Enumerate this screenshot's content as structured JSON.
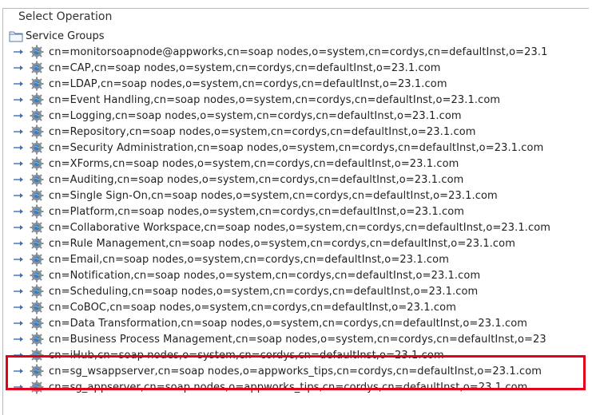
{
  "panel": {
    "title": "Select Operation"
  },
  "tree": {
    "root_label": "Service Groups",
    "items": [
      "cn=monitorsoapnode@appworks,cn=soap nodes,o=system,cn=cordys,cn=defaultInst,o=23.1",
      "cn=CAP,cn=soap nodes,o=system,cn=cordys,cn=defaultInst,o=23.1.com",
      "cn=LDAP,cn=soap nodes,o=system,cn=cordys,cn=defaultInst,o=23.1.com",
      "cn=Event Handling,cn=soap nodes,o=system,cn=cordys,cn=defaultInst,o=23.1.com",
      "cn=Logging,cn=soap nodes,o=system,cn=cordys,cn=defaultInst,o=23.1.com",
      "cn=Repository,cn=soap nodes,o=system,cn=cordys,cn=defaultInst,o=23.1.com",
      "cn=Security Administration,cn=soap nodes,o=system,cn=cordys,cn=defaultInst,o=23.1.com",
      "cn=XForms,cn=soap nodes,o=system,cn=cordys,cn=defaultInst,o=23.1.com",
      "cn=Auditing,cn=soap nodes,o=system,cn=cordys,cn=defaultInst,o=23.1.com",
      "cn=Single Sign-On,cn=soap nodes,o=system,cn=cordys,cn=defaultInst,o=23.1.com",
      "cn=Platform,cn=soap nodes,o=system,cn=cordys,cn=defaultInst,o=23.1.com",
      "cn=Collaborative Workspace,cn=soap nodes,o=system,cn=cordys,cn=defaultInst,o=23.1.com",
      "cn=Rule Management,cn=soap nodes,o=system,cn=cordys,cn=defaultInst,o=23.1.com",
      "cn=Email,cn=soap nodes,o=system,cn=cordys,cn=defaultInst,o=23.1.com",
      "cn=Notification,cn=soap nodes,o=system,cn=cordys,cn=defaultInst,o=23.1.com",
      "cn=Scheduling,cn=soap nodes,o=system,cn=cordys,cn=defaultInst,o=23.1.com",
      "cn=CoBOC,cn=soap nodes,o=system,cn=cordys,cn=defaultInst,o=23.1.com",
      "cn=Data Transformation,cn=soap nodes,o=system,cn=cordys,cn=defaultInst,o=23.1.com",
      "cn=Business Process Management,cn=soap nodes,o=system,cn=cordys,cn=defaultInst,o=23",
      "cn=iHub,cn=soap nodes,o=system,cn=cordys,cn=defaultInst,o=23.1.com",
      "cn=sg_wsappserver,cn=soap nodes,o=appworks_tips,cn=cordys,cn=defaultInst,o=23.1.com",
      "cn=sg_appserver,cn=soap nodes,o=appworks_tips,cn=cordys,cn=defaultInst,o=23.1.com"
    ]
  },
  "icons": {
    "root": "folder-icon",
    "item": "gear-icon",
    "expander": "tree-expand-handle-icon"
  },
  "colors": {
    "highlight": "#e3001b",
    "gear": "#8a8f96",
    "globe": "#3a7bd5",
    "handle": "#3b6fb6"
  }
}
